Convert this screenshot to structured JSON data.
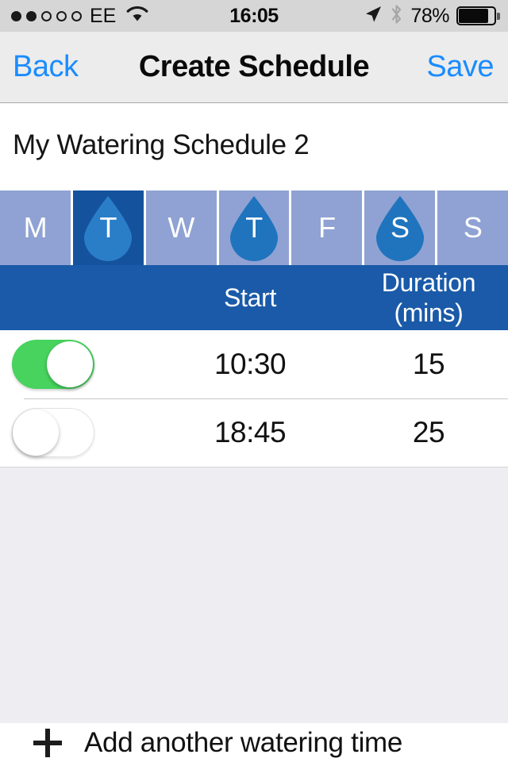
{
  "status_bar": {
    "signal_dots_filled": 2,
    "signal_dots_total": 5,
    "carrier": "EE",
    "wifi_icon": "wifi-icon",
    "time": "16:05",
    "location_icon": "location-arrow-icon",
    "bluetooth_icon": "bluetooth-icon",
    "battery_percent": "78%",
    "battery_level": 78
  },
  "nav": {
    "back_label": "Back",
    "title": "Create Schedule",
    "save_label": "Save",
    "accent_color": "#1a8cff"
  },
  "schedule": {
    "name_value": "My Watering Schedule 2",
    "name_placeholder": "Schedule name"
  },
  "days": [
    {
      "letter": "M",
      "name": "monday",
      "active": false,
      "selected": false
    },
    {
      "letter": "T",
      "name": "tuesday",
      "active": true,
      "selected": true
    },
    {
      "letter": "W",
      "name": "wednesday",
      "active": false,
      "selected": false
    },
    {
      "letter": "T",
      "name": "thursday",
      "active": true,
      "selected": false
    },
    {
      "letter": "F",
      "name": "friday",
      "active": false,
      "selected": false
    },
    {
      "letter": "S",
      "name": "saturday",
      "active": true,
      "selected": false
    },
    {
      "letter": "S",
      "name": "sunday",
      "active": false,
      "selected": false
    }
  ],
  "table": {
    "header": {
      "start": "Start",
      "duration_line1": "Duration",
      "duration_line2": "(mins)"
    },
    "header_color": "#1a5aa8",
    "rows": [
      {
        "enabled": true,
        "start": "10:30",
        "duration": "15"
      },
      {
        "enabled": false,
        "start": "18:45",
        "duration": "25"
      }
    ]
  },
  "footer": {
    "add_icon": "plus-icon",
    "add_label": "Add another watering time"
  },
  "colors": {
    "day_inactive": "#8fa2d3",
    "day_selected_bg": "#14529e",
    "droplet_on_light": "#1f74bd",
    "droplet_on_dark": "#2a7ec8",
    "toggle_on": "#47d35e",
    "table_header": "#1a5aa8",
    "page_gray": "#eeeef2"
  }
}
